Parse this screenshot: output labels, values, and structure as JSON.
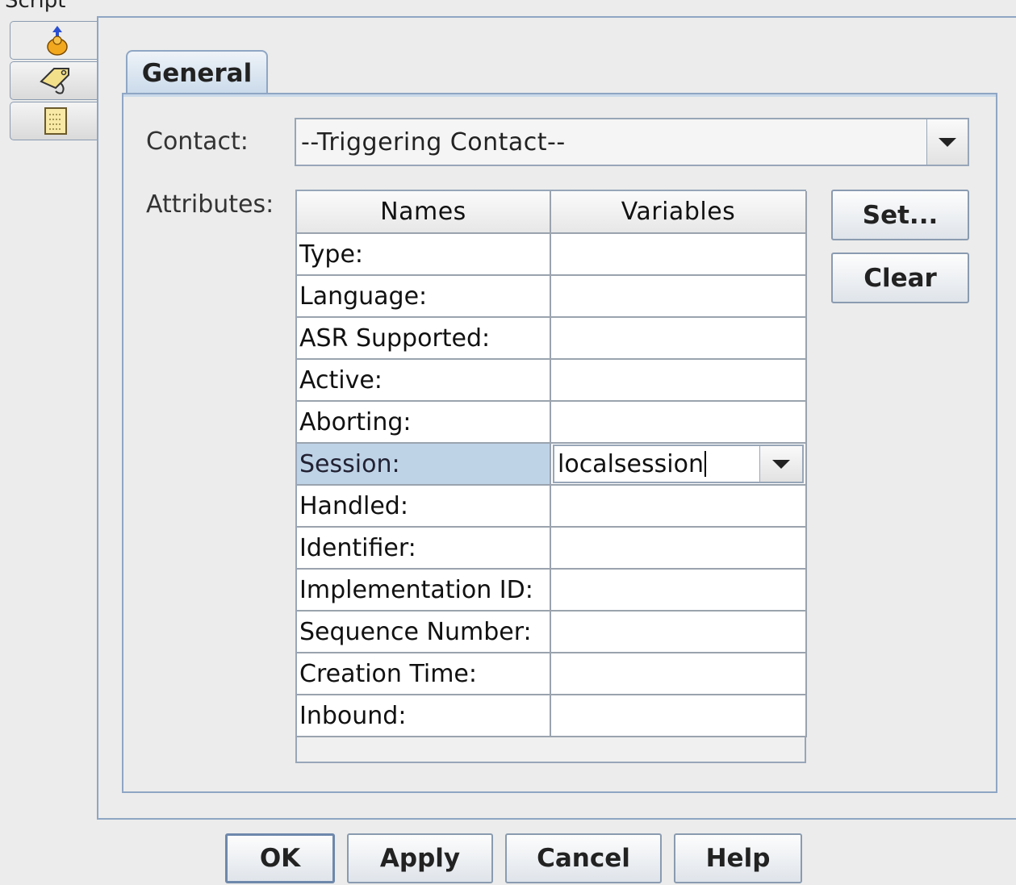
{
  "window": {
    "title_fragment": "Script"
  },
  "side_tabs": [
    {
      "icon": "bell-person-icon",
      "active": true
    },
    {
      "icon": "tag-icon",
      "active": false
    },
    {
      "icon": "note-icon",
      "active": false
    }
  ],
  "tab": {
    "label": "General"
  },
  "contact": {
    "label": "Contact:",
    "value": "--Triggering Contact--"
  },
  "attributes": {
    "label": "Attributes:",
    "columns": [
      "Names",
      "Variables"
    ],
    "rows": [
      {
        "name": "Type:",
        "variable": ""
      },
      {
        "name": "Language:",
        "variable": ""
      },
      {
        "name": "ASR Supported:",
        "variable": ""
      },
      {
        "name": "Active:",
        "variable": ""
      },
      {
        "name": "Aborting:",
        "variable": ""
      },
      {
        "name": "Session:",
        "variable": "localsession",
        "selected": true
      },
      {
        "name": "Handled:",
        "variable": ""
      },
      {
        "name": "Identifier:",
        "variable": ""
      },
      {
        "name": "Implementation ID:",
        "variable": ""
      },
      {
        "name": "Sequence Number:",
        "variable": ""
      },
      {
        "name": "Creation Time:",
        "variable": ""
      },
      {
        "name": "Inbound:",
        "variable": ""
      }
    ]
  },
  "side_buttons": {
    "set": "Set...",
    "clear": "Clear"
  },
  "footer": {
    "ok": "OK",
    "apply": "Apply",
    "cancel": "Cancel",
    "help": "Help"
  }
}
